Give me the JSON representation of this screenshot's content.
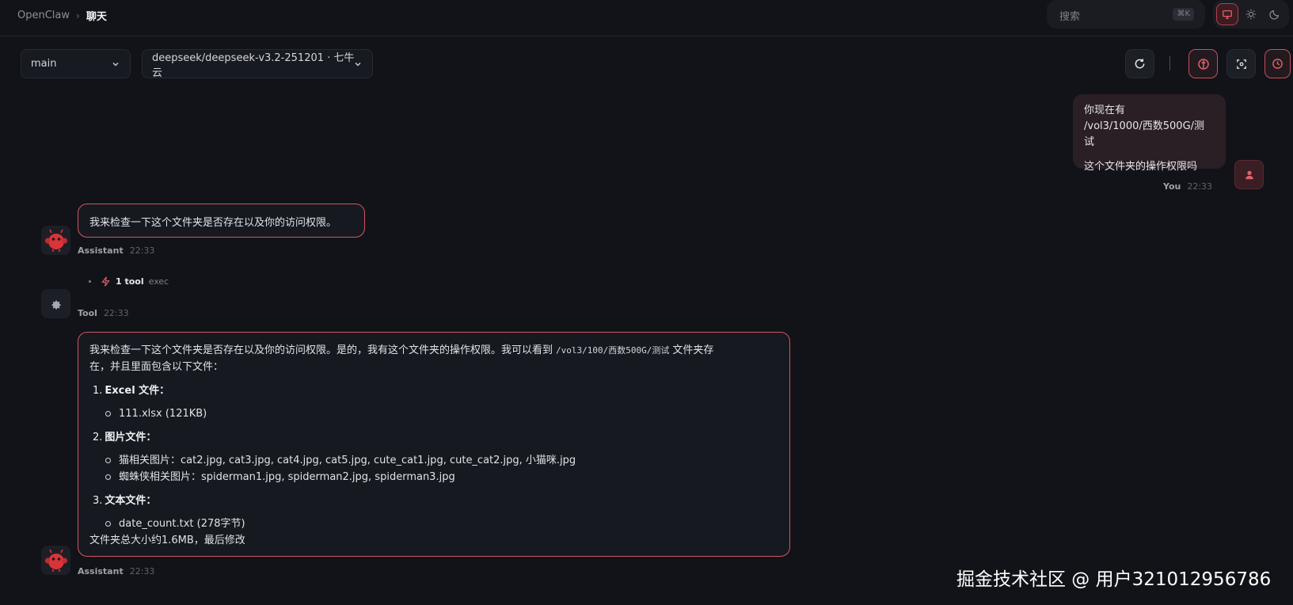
{
  "breadcrumb": {
    "root": "OpenClaw",
    "separator": "›",
    "current": "聊天"
  },
  "search": {
    "placeholder": "搜索",
    "shortcut": "⌘K"
  },
  "theme": {
    "options": [
      "monitor-icon",
      "sun-icon",
      "moon-icon"
    ],
    "active": "monitor-icon"
  },
  "controls": {
    "session_select": "main",
    "model_select": "deepseek/deepseek-v3.2-251201 · 七牛云",
    "buttons": [
      "refresh-icon",
      "brain-icon",
      "focus-icon",
      "clock-icon"
    ]
  },
  "messages": {
    "user": {
      "lines": [
        "你现在有",
        "/vol3/1000/西数500G/测试",
        "这个文件夹的操作权限吗"
      ],
      "sender": "You",
      "time": "22:33"
    },
    "assistant1": {
      "text": "我来检查一下这个文件夹是否存在以及你的访问权限。",
      "sender": "Assistant",
      "time": "22:33"
    },
    "tool": {
      "count_label": "1 tool",
      "name": "exec",
      "sender": "Tool",
      "time": "22:33"
    },
    "assistant2": {
      "intro_a": "我来检查一下这个文件夹是否存在以及你的访问权限。是的，我有这个文件夹的操作权限。我可以看到",
      "intro_path": "/vol3/100/西数500G/测试",
      "intro_b": "文件夹存",
      "intro_c": "在，并且里面包含以下文件：",
      "sections": [
        {
          "num": "1.",
          "title": "Excel 文件：",
          "items": [
            "111.xlsx (121KB)"
          ]
        },
        {
          "num": "2.",
          "title": "图片文件：",
          "items": [
            "猫相关图片：cat2.jpg, cat3.jpg, cat4.jpg, cat5.jpg, cute_cat1.jpg, cute_cat2.jpg, 小猫咪.jpg",
            "蜘蛛侠相关图片：spiderman1.jpg, spiderman2.jpg, spiderman3.jpg"
          ]
        },
        {
          "num": "3.",
          "title": "文本文件：",
          "items": [
            "date_count.txt (278字节)"
          ]
        }
      ],
      "footer": "文件夹总大小约1.6MB，最后修改",
      "sender": "Assistant",
      "time": "22:33"
    }
  },
  "watermark": "掘金技术社区 @ 用户321012956786",
  "colors": {
    "accent": "#d0565f",
    "background": "#111318",
    "bubble_user": "#2a1f24"
  }
}
